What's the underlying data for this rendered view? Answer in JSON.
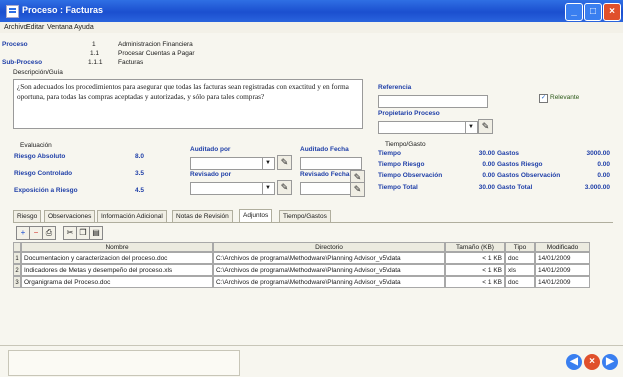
{
  "window": {
    "title": "Proceso : Facturas"
  },
  "menu": [
    "Archivo",
    "Editar",
    "Ventana",
    "Ayuda"
  ],
  "header": {
    "proceso_label": "Proceso",
    "subproceso_label": "Sub-Proceso",
    "codes": [
      "1",
      "1.1",
      "1.1.1"
    ],
    "names": [
      "Administracion Financiera",
      "Procesar Cuentas a Pagar",
      "Facturas"
    ]
  },
  "description": {
    "label": "Descripción/Guía",
    "text": "¿Son adecuados los procedimientos para asegurar que todas las facturas sean registradas con exactitud y en forma oportuna, para todas las compras aceptadas y autorizadas, y sólo para tales compras?"
  },
  "referencia": {
    "label": "Referencia",
    "value": ""
  },
  "relevante": {
    "label": "Relevante",
    "checked": true
  },
  "propietario": {
    "label": "Propietario Proceso",
    "value": ""
  },
  "evaluacion": {
    "label": "Evaluación",
    "rows": [
      {
        "label": "Riesgo Absoluto",
        "value": "8.0"
      },
      {
        "label": "Riesgo Controlado",
        "value": "3.5"
      },
      {
        "label": "Exposición a Riesgo",
        "value": "4.5"
      }
    ]
  },
  "auditado_por": {
    "label": "Auditado por",
    "value": ""
  },
  "auditado_fecha": {
    "label": "Auditado Fecha",
    "value": ""
  },
  "revisado_por": {
    "label": "Revisado por",
    "value": ""
  },
  "revisado_fecha": {
    "label": "Revisado Fecha",
    "value": ""
  },
  "tiempo_gasto": {
    "label": "Tiempo/Gasto",
    "rows": [
      {
        "label": "Tiempo",
        "value": "30.00",
        "gasto_label": "Gastos",
        "gasto_value": "3000.00"
      },
      {
        "label": "Tiempo Riesgo",
        "value": "0.00",
        "gasto_label": "Gastos Riesgo",
        "gasto_value": "0.00"
      },
      {
        "label": "Tiempo Observación",
        "value": "0.00",
        "gasto_label": "Gastos Observación",
        "gasto_value": "0.00"
      },
      {
        "label": "Tiempo Total",
        "value": "30.00",
        "gasto_label": "Gasto Total",
        "gasto_value": "3.000.00"
      }
    ]
  },
  "tabs": [
    "Riesgo",
    "Observaciones",
    "Información Adicional",
    "Notas de Revisión",
    "Adjuntos",
    "Tiempo/Gastos"
  ],
  "active_tab": "Adjuntos",
  "toolbar_icons": [
    "add-icon",
    "delete-icon",
    "print-icon",
    "cut-icon",
    "copy-icon",
    "paste-icon"
  ],
  "grid": {
    "columns": [
      "Nombre",
      "Directorio",
      "Tamaño (KB)",
      "Tipo",
      "Modificado"
    ],
    "rows": [
      {
        "num": "1",
        "nombre": "Documentacion y caracterizacion del proceso.doc",
        "directorio": "C:\\Archivos de programa\\Methodware\\Planning Advisor_v5\\data",
        "tamano": "< 1 KB",
        "tipo": "doc",
        "modificado": "14/01/2009"
      },
      {
        "num": "2",
        "nombre": "Indicadores de Metas y desempeño del proceso.xls",
        "directorio": "C:\\Archivos de programa\\Methodware\\Planning Advisor_v5\\data",
        "tamano": "< 1 KB",
        "tipo": "xls",
        "modificado": "14/01/2009"
      },
      {
        "num": "3",
        "nombre": "Organigrama del Proceso.doc",
        "directorio": "C:\\Archivos de programa\\Methodware\\Planning Advisor_v5\\data",
        "tamano": "< 1 KB",
        "tipo": "doc",
        "modificado": "14/01/2009"
      }
    ]
  }
}
